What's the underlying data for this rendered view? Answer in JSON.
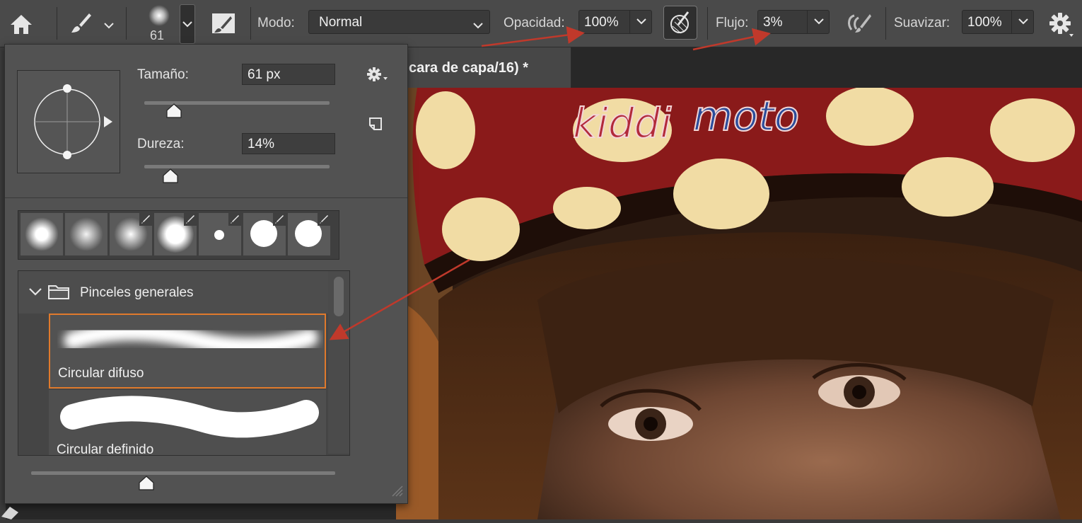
{
  "toolbar": {
    "brush_size": "61",
    "mode_label": "Modo:",
    "mode_value": "Normal",
    "opacity_label": "Opacidad:",
    "opacity_value": "100%",
    "flow_label": "Flujo:",
    "flow_value": "3%",
    "smoothing_label": "Suavizar:",
    "smoothing_value": "100%"
  },
  "document": {
    "tab_title": "cara de capa/16) *"
  },
  "brush_panel": {
    "size_label": "Tamaño:",
    "size_value": "61 px",
    "size_fraction": 0.16,
    "hardness_label": "Dureza:",
    "hardness_value": "14%",
    "hardness_fraction": 0.14,
    "folder_name": "Pinceles generales",
    "brushes": [
      {
        "name": "Circular difuso",
        "selected": true
      },
      {
        "name": "Circular definido",
        "selected": false
      }
    ],
    "preview_zoom_fraction": 0.38
  },
  "colors": {
    "accent": "#e07a2c",
    "annotation": "#c0392b"
  }
}
